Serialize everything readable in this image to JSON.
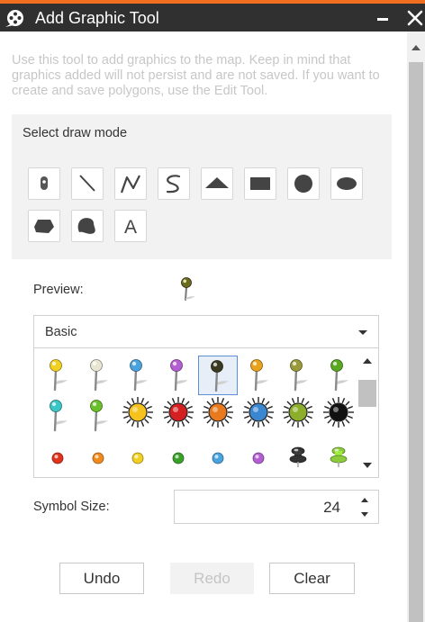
{
  "window": {
    "title": "Add Graphic Tool",
    "app_icon": "film-reel-icon",
    "accent_color": "#f26f21",
    "titlebar_color": "#303030"
  },
  "intro": {
    "text": "Use this tool to add graphics to the map. Keep in mind that graphics added will not persist and are not saved. If you want to create and save polygons, use the Edit Tool."
  },
  "draw_mode": {
    "label": "Select draw mode",
    "modes": [
      {
        "name": "point",
        "icon": "point-icon"
      },
      {
        "name": "line",
        "icon": "line-icon"
      },
      {
        "name": "polyline",
        "icon": "polyline-icon"
      },
      {
        "name": "freehand-polyline",
        "icon": "freehand-line-icon"
      },
      {
        "name": "triangle",
        "icon": "triangle-icon"
      },
      {
        "name": "rectangle",
        "icon": "rectangle-icon"
      },
      {
        "name": "circle",
        "icon": "circle-icon"
      },
      {
        "name": "ellipse",
        "icon": "ellipse-icon"
      },
      {
        "name": "polygon",
        "icon": "polygon-icon"
      },
      {
        "name": "freehand-polygon",
        "icon": "freehand-polygon-icon"
      },
      {
        "name": "text",
        "icon": "text-icon",
        "glyph": "A"
      }
    ]
  },
  "preview": {
    "label": "Preview:",
    "icon": "olive-pushpin-icon"
  },
  "symbol_set": {
    "selected": "Basic"
  },
  "symbols": {
    "row1": [
      {
        "kind": "pushpin",
        "color": "#f2d022"
      },
      {
        "kind": "pushpin",
        "color": "#e8e6d2"
      },
      {
        "kind": "pushpin",
        "color": "#4aa3df"
      },
      {
        "kind": "pushpin",
        "color": "#b45fd1"
      },
      {
        "kind": "pushpin",
        "color": "#3a3a20",
        "selected": true
      },
      {
        "kind": "pushpin",
        "color": "#e8a21c"
      },
      {
        "kind": "pushpin",
        "color": "#9a9a3a"
      },
      {
        "kind": "pushpin",
        "color": "#5aa822"
      }
    ],
    "row2": [
      {
        "kind": "pushpin",
        "color": "#39c6c6"
      },
      {
        "kind": "pushpin",
        "color": "#6abf2a"
      },
      {
        "kind": "sun",
        "color": "#f6c21e"
      },
      {
        "kind": "sun",
        "color": "#d42020"
      },
      {
        "kind": "sun",
        "color": "#e8791c"
      },
      {
        "kind": "sun",
        "color": "#3a86d0"
      },
      {
        "kind": "sun",
        "color": "#8cae2a"
      },
      {
        "kind": "sun",
        "color": "#111111"
      }
    ],
    "row3": [
      {
        "kind": "dot",
        "color": "#e0331c"
      },
      {
        "kind": "dot",
        "color": "#f08a1c"
      },
      {
        "kind": "dot",
        "color": "#f2d022"
      },
      {
        "kind": "dot",
        "color": "#3aa02a"
      },
      {
        "kind": "dot",
        "color": "#4aa3df"
      },
      {
        "kind": "dot",
        "color": "#b45fd1"
      },
      {
        "kind": "thumbtack",
        "color": "#333333"
      },
      {
        "kind": "thumbtack",
        "color": "#8ccc3a"
      }
    ]
  },
  "symbol_size": {
    "label": "Symbol Size:",
    "value": "24"
  },
  "buttons": {
    "undo": "Undo",
    "redo": "Redo",
    "clear": "Clear"
  }
}
